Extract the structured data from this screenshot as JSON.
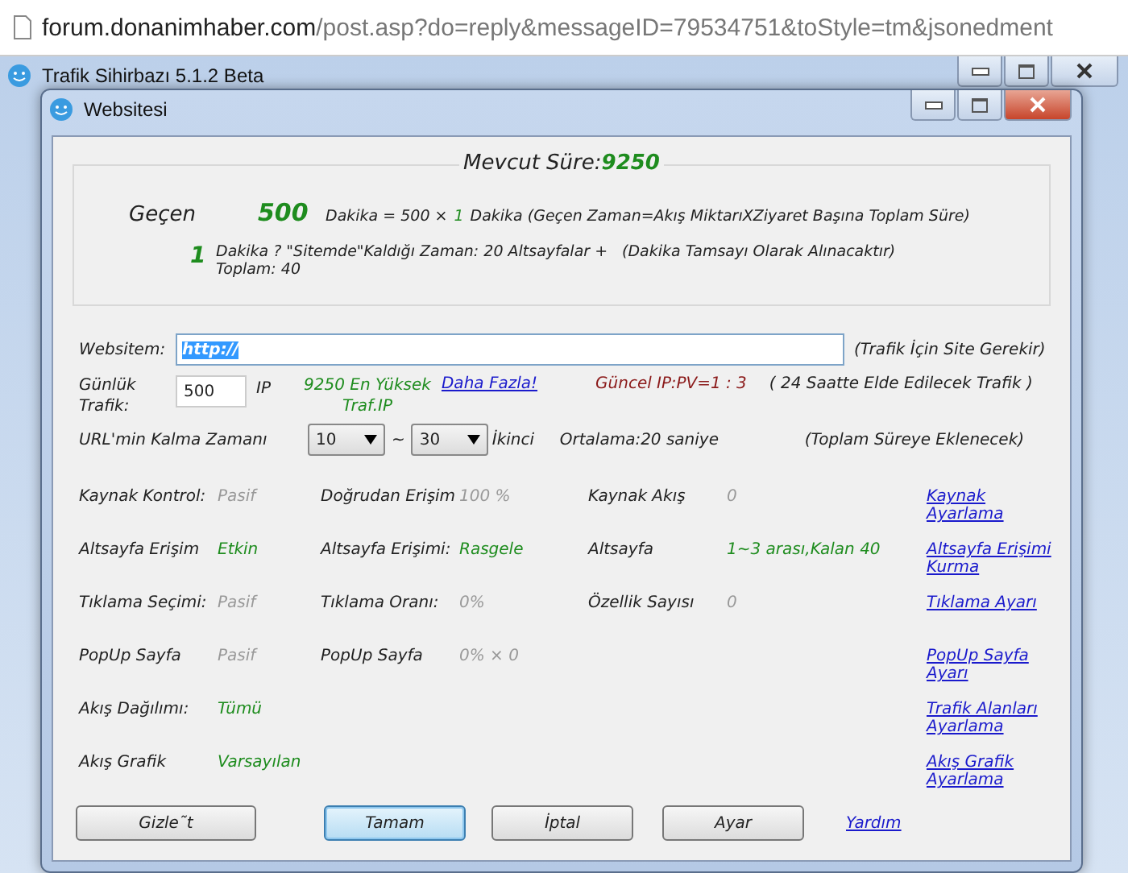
{
  "address_bar": {
    "domain": "forum.donanimhaber.com",
    "path": "/post.asp?do=reply&messageID=79534751&toStyle=tm&jsonedment"
  },
  "parent_window": {
    "title": "Trafik Sihirbazı 5.1.2 Beta"
  },
  "dialog": {
    "title": "Websitesi"
  },
  "summary": {
    "heading_label": "Mevcut Süre:",
    "heading_value": "9250",
    "label": "Geçen",
    "value": "500",
    "formula": "Dakika = 500 ×",
    "multiplier": "1",
    "formula_rest": "Dakika (Geçen Zaman=Akış MiktarıXZiyaret Başına Toplam Süre)",
    "minutes": "1",
    "note": "Dakika ? \"Sitemde\"Kaldığı Zaman: 20 Altsayfalar + Toplam: 40",
    "note2": "(Dakika Tamsayı Olarak Alınacaktır)"
  },
  "website": {
    "label": "Websitem:",
    "value": "http://",
    "hint": "(Trafik İçin Site Gerekir)"
  },
  "daily": {
    "label": "Günlük Trafik:",
    "value": "500",
    "unit": "IP",
    "max": "9250 En Yüksek Traf.IP",
    "link": "Daha Fazla!",
    "ratio": "Güncel IP:PV=1 : 3",
    "note": "( 24 Saatte Elde Edilecek Trafik )"
  },
  "stay": {
    "label": "URL'min Kalma Zamanı",
    "min": "10",
    "sep": "~",
    "max": "30",
    "unit": "İkinci",
    "average": "Ortalama:20 saniye",
    "note": "(Toplam Süreye Eklenecek)"
  },
  "settings": [
    {
      "cells": [
        {
          "label": "Kaynak Kontrol:",
          "value": "Pasif",
          "color": "#999999"
        },
        {
          "label": "Doğrudan Erişim",
          "value": "100 %",
          "color": "#999999"
        },
        {
          "label": "Kaynak Akış",
          "value": "0",
          "color": "#999999"
        }
      ],
      "link": "Kaynak Ayarlama"
    },
    {
      "cells": [
        {
          "label": "Altsayfa Erişim",
          "value": "Etkin",
          "color": "#1e8c1e"
        },
        {
          "label": "Altsayfa Erişimi:",
          "value": "Rasgele",
          "color": "#1e8c1e"
        },
        {
          "label": "Altsayfa",
          "value": "1~3 arası,Kalan 40",
          "color": "#1e8c1e"
        }
      ],
      "link": "Altsayfa Erişimi Kurma"
    },
    {
      "cells": [
        {
          "label": "Tıklama Seçimi:",
          "value": "Pasif",
          "color": "#999999"
        },
        {
          "label": "Tıklama Oranı:",
          "value": "0%",
          "color": "#999999"
        },
        {
          "label": "Özellik Sayısı",
          "value": "0",
          "color": "#999999"
        }
      ],
      "link": "Tıklama Ayarı"
    },
    {
      "cells": [
        {
          "label": "PopUp Sayfa",
          "value": "Pasif",
          "color": "#999999"
        },
        {
          "label": "PopUp Sayfa",
          "value": "0% × 0",
          "color": "#999999"
        }
      ],
      "link": "PopUp Sayfa Ayarı"
    },
    {
      "cells": [
        {
          "label": "Akış Dağılımı:",
          "value": "Tümü",
          "color": "#1e8c1e"
        }
      ],
      "link": "Trafik Alanları Ayarlama"
    },
    {
      "cells": [
        {
          "label": "Akış Grafik",
          "value": "Varsayılan",
          "color": "#1e8c1e"
        }
      ],
      "link": "Akış Grafik Ayarlama"
    }
  ],
  "buttons": [
    {
      "label": "Gizle˜t",
      "default": false
    },
    {
      "label": "Tamam",
      "default": true
    },
    {
      "label": "İptal",
      "default": false
    },
    {
      "label": "Ayar",
      "default": false
    }
  ],
  "help_link": "Yardım"
}
